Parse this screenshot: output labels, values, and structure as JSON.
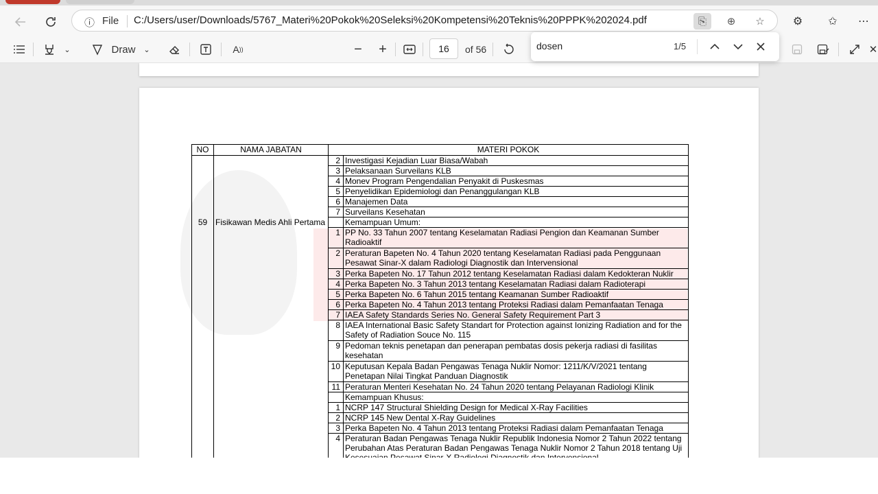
{
  "browser": {
    "file_label": "File",
    "url": "C:/Users/user/Downloads/5767_Materi%20Pokok%20Seleksi%20Kompetensi%20Teknis%20PPPK%202024.pdf"
  },
  "pdf_toolbar": {
    "draw_label": "Draw",
    "current_page": "16",
    "total_pages": "of 56"
  },
  "find": {
    "query": "dosen",
    "count": "1/5"
  },
  "table": {
    "headers": {
      "no": "NO",
      "jabatan": "NAMA JABATAN",
      "materi": "MATERI POKOK"
    },
    "rows": [
      {
        "no": "",
        "jabatan": "",
        "num": "2",
        "text": "Investigasi Kejadian Luar Biasa/Wabah"
      },
      {
        "no": "",
        "jabatan": "",
        "num": "3",
        "text": "Pelaksanaan Surveilans KLB"
      },
      {
        "no": "",
        "jabatan": "",
        "num": "4",
        "text": "Monev Program Pengendalian Penyakit di Puskesmas"
      },
      {
        "no": "",
        "jabatan": "",
        "num": "5",
        "text": "Penyelidikan Epidemiologi dan Penanggulangan KLB"
      },
      {
        "no": "",
        "jabatan": "",
        "num": "6",
        "text": "Manajemen Data"
      },
      {
        "no": "",
        "jabatan": "",
        "num": "7",
        "text": "Surveilans Kesehatan"
      },
      {
        "no": "59",
        "jabatan": "Fisikawan Medis Ahli Pertama",
        "num": "",
        "text": "Kemampuan Umum:"
      },
      {
        "no": "",
        "jabatan": "",
        "num": "1",
        "text": "PP No. 33 Tahun 2007 tentang Keselamatan Radiasi Pengion dan Keamanan Sumber Radioaktif"
      },
      {
        "no": "",
        "jabatan": "",
        "num": "2",
        "text": "Peraturan Bapeten No. 4 Tahun 2020 tentang Keselamatan Radiasi pada Penggunaan Pesawat Sinar-X dalam Radiologi Diagnostik dan Intervensional"
      },
      {
        "no": "",
        "jabatan": "",
        "num": "3",
        "text": "Perka Bapeten No. 17 Tahun 2012 tentang Keselamatan Radiasi dalam Kedokteran Nuklir"
      },
      {
        "no": "",
        "jabatan": "",
        "num": "4",
        "text": "Perka Bapeten No. 3 Tahun 2013 tentang Keselamatan Radiasi dalam Radioterapi"
      },
      {
        "no": "",
        "jabatan": "",
        "num": "5",
        "text": "Perka Bapeten No. 6 Tahun 2015 tentang Keamanan Sumber Radioaktif"
      },
      {
        "no": "",
        "jabatan": "",
        "num": "6",
        "text": "Perka Bapeten No. 4 Tahun 2013 tentang Proteksi Radiasi dalam Pemanfaatan Tenaga"
      },
      {
        "no": "",
        "jabatan": "",
        "num": "7",
        "text": "IAEA Safety Standards Series No. General Safety Requirement Part 3"
      },
      {
        "no": "",
        "jabatan": "",
        "num": "8",
        "text": "IAEA International Basic Safety Standart for Protection against Ionizing Radiation and for the Safety of Radiation Souce No. 115"
      },
      {
        "no": "",
        "jabatan": "",
        "num": "9",
        "text": "Pedoman teknis penetapan dan penerapan pembatas dosis pekerja radiasi di fasilitas kesehatan"
      },
      {
        "no": "",
        "jabatan": "",
        "num": "10",
        "text": "Keputusan Kepala Badan Pengawas Tenaga Nuklir Nomor: 1211/K/V/2021 tentang Penetapan Nilai Tingkat Panduan Diagnostik"
      },
      {
        "no": "",
        "jabatan": "",
        "num": "11",
        "text": "Peraturan Menteri Kesehatan No. 24 Tahun 2020 tentang Pelayanan Radiologi Klinik"
      },
      {
        "no": "",
        "jabatan": "",
        "num": "",
        "text": "Kemampuan Khusus:"
      },
      {
        "no": "",
        "jabatan": "",
        "num": "1",
        "text": "NCRP 147 Structural Shielding Design for Medical X-Ray Facilities"
      },
      {
        "no": "",
        "jabatan": "",
        "num": "2",
        "text": "NCRP 145 New Dental X-Ray Guidelines"
      },
      {
        "no": "",
        "jabatan": "",
        "num": "3",
        "text": "Perka Bapeten No. 4 Tahun 2013 tentang Proteksi Radiasi dalam Pemanfaatan Tenaga"
      },
      {
        "no": "",
        "jabatan": "",
        "num": "4",
        "text": "Peraturan Badan Pengawas Tenaga Nuklir Republik Indonesia Nomor 2 Tahun 2022 tentang Perubahan Atas Peraturan Badan Pengawas Tenaga Nuklir Nomor 2 Tahun 2018 tentang Uji Kesesuaian Pesawat Sinar-X Radiologi Diagnostik dan Intervensional"
      }
    ]
  }
}
